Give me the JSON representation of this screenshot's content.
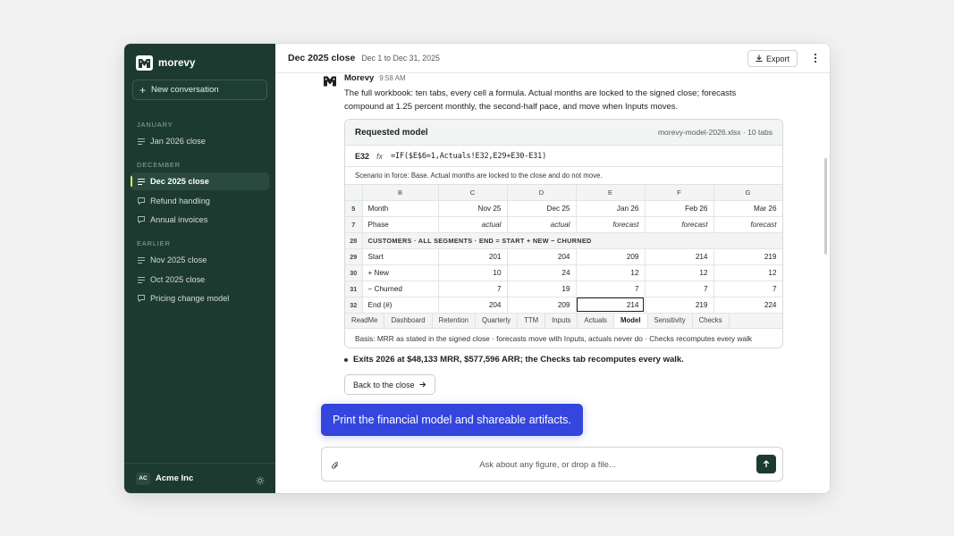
{
  "sidebar": {
    "brand": "morevy",
    "new_conversation": "New conversation",
    "sections": [
      {
        "label": "JANUARY",
        "items": [
          {
            "label": "Jan 2026 close",
            "icon": "list-icon"
          }
        ]
      },
      {
        "label": "DECEMBER",
        "items": [
          {
            "label": "Dec 2025 close",
            "icon": "list-icon",
            "active": true
          },
          {
            "label": "Refund handling",
            "icon": "chat-icon"
          },
          {
            "label": "Annual invoices",
            "icon": "chat-icon"
          }
        ]
      },
      {
        "label": "EARLIER",
        "items": [
          {
            "label": "Nov 2025 close",
            "icon": "list-icon"
          },
          {
            "label": "Oct 2025 close",
            "icon": "list-icon"
          },
          {
            "label": "Pricing change model",
            "icon": "chat-icon"
          }
        ]
      }
    ],
    "org_initials": "AC",
    "org_name": "Acme Inc"
  },
  "header": {
    "title": "Dec 2025 close",
    "range": "Dec 1 to Dec 31, 2025",
    "export_label": "Export"
  },
  "message": {
    "author": "Morevy",
    "time": "9:58 AM",
    "body": "The full workbook: ten tabs, every cell a formula. Actual months are locked to the signed close; forecasts compound at 1.25 percent monthly, the second-half pace, and move when Inputs moves.",
    "bullet": "Exits 2026 at $48,133 MRR, $577,596 ARR; the Checks tab recomputes every walk.",
    "back_button": "Back to the close"
  },
  "card": {
    "title": "Requested model",
    "file": "morevy-model-2026.xlsx · 10 tabs",
    "cell_ref": "E32",
    "fx": "fx",
    "formula": "=IF($E$6=1,Actuals!E32,E29+E30-E31)",
    "scenario": "Scenario in force: Base. Actual months are locked to the close and do not move.",
    "columns": [
      "B",
      "C",
      "D",
      "E",
      "F",
      "G"
    ],
    "rows": {
      "month": {
        "num": "5",
        "label": "Month",
        "values": [
          "Nov 25",
          "Dec 25",
          "Jan 26",
          "Feb 26",
          "Mar 26"
        ]
      },
      "phase": {
        "num": "7",
        "label": "Phase",
        "values": [
          "actual",
          "actual",
          "forecast",
          "forecast",
          "forecast"
        ]
      },
      "section": {
        "num": "28",
        "label": "CUSTOMERS · ALL SEGMENTS · END = START + NEW − CHURNED"
      },
      "start": {
        "num": "29",
        "label": "Start",
        "values": [
          "201",
          "204",
          "209",
          "214",
          "219"
        ]
      },
      "new": {
        "num": "30",
        "label": "+ New",
        "values": [
          "10",
          "24",
          "12",
          "12",
          "12"
        ]
      },
      "churned": {
        "num": "31",
        "label": "− Churned",
        "values": [
          "7",
          "19",
          "7",
          "7",
          "7"
        ]
      },
      "end": {
        "num": "32",
        "label": "End (#)",
        "values": [
          "204",
          "209",
          "214",
          "219",
          "224"
        ]
      }
    },
    "tabs": [
      "ReadMe",
      "Dashboard",
      "Retention",
      "Quarterly",
      "TTM",
      "Inputs",
      "Actuals",
      "Model",
      "Sensitivity",
      "Checks"
    ],
    "active_tab": "Model",
    "basis": "Basis: MRR as stated in the signed close · forecasts move with Inputs, actuals never do · Checks recomputes every walk"
  },
  "user_message": "Print the financial model and shareable artifacts.",
  "composer": {
    "placeholder": "Ask about any figure, or drop a file..."
  },
  "colors": {
    "sidebar_bg": "#1d3a30",
    "accent_blue": "#3446dd",
    "active_marker": "#d9ec5a"
  }
}
